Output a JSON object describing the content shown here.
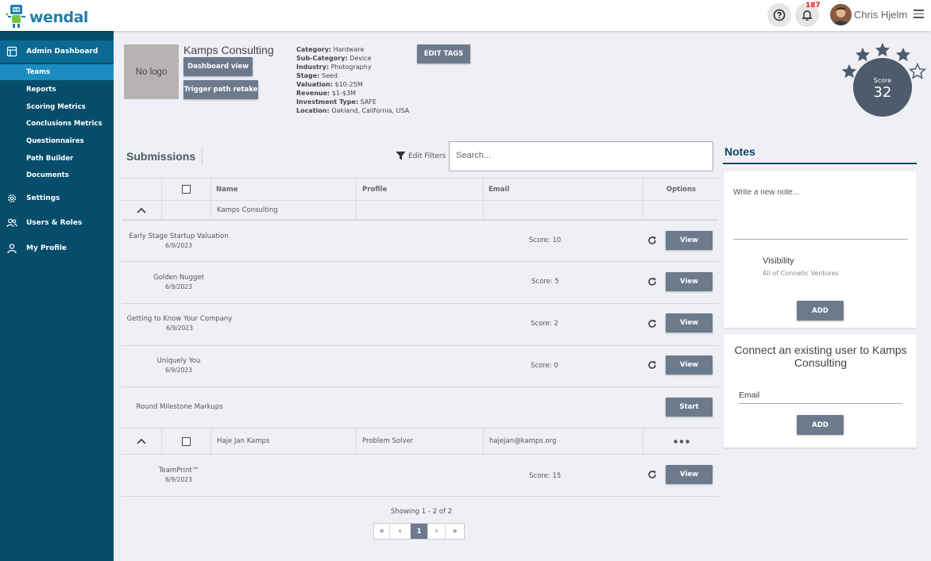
{
  "app": {
    "logo_text": "wendal",
    "notification_count": "187",
    "user_name": "Chris Hjelm"
  },
  "sidebar": {
    "items": [
      {
        "label": "Admin Dashboard",
        "icon": "dashboard-icon",
        "active": true
      },
      {
        "label": "Teams",
        "sub": true,
        "active": true
      },
      {
        "label": "Reports",
        "sub": true
      },
      {
        "label": "Scoring Metrics",
        "sub": true
      },
      {
        "label": "Conclusions Metrics",
        "sub": true
      },
      {
        "label": "Questionnaires",
        "sub": true
      },
      {
        "label": "Path Builder",
        "sub": true
      },
      {
        "label": "Documents",
        "sub": true
      },
      {
        "label": "Settings",
        "icon": "gear-icon"
      },
      {
        "label": "Users & Roles",
        "icon": "users-icon"
      },
      {
        "label": "My Profile",
        "icon": "user-icon"
      }
    ]
  },
  "company": {
    "logo_placeholder": "No logo",
    "name": "Kamps Consulting",
    "dashboard_button": "Dashboard view",
    "retake_button": "Trigger path retake",
    "edit_tags_button": "EDIT TAGS",
    "details": [
      {
        "key": "Category:",
        "value": "Hardware"
      },
      {
        "key": "Sub-Category:",
        "value": "Device"
      },
      {
        "key": "Industry:",
        "value": "Photography"
      },
      {
        "key": "Stage:",
        "value": "Seed"
      },
      {
        "key": "Valuation:",
        "value": "$10-25M"
      },
      {
        "key": "Revenue:",
        "value": "$1-$3M"
      },
      {
        "key": "Investment Type:",
        "value": "SAFE"
      },
      {
        "key": "Location:",
        "value": "Oakland, California, USA"
      }
    ],
    "score_label": "Score",
    "score_value": "32",
    "stars_filled": 4,
    "stars_total": 5
  },
  "submissions": {
    "title": "Submissions",
    "filter_label": "Edit Filters",
    "search_placeholder": "Search...",
    "columns": [
      "Name",
      "Profile",
      "Email",
      "Options"
    ],
    "groups": [
      {
        "name": "Kamps Consulting",
        "profile": "",
        "email": "",
        "items": [
          {
            "name": "Early Stage Startup Valuation",
            "date": "6/9/2023",
            "score": "Score: 10",
            "action": "View"
          },
          {
            "name": "Golden Nugget",
            "date": "6/9/2023",
            "score": "Score: 5",
            "action": "View"
          },
          {
            "name": "Getting to Know Your Company",
            "date": "6/9/2023",
            "score": "Score: 2",
            "action": "View"
          },
          {
            "name": "Uniquely You",
            "date": "6/9/2023",
            "score": "Score: 0",
            "action": "View"
          },
          {
            "name": "Round Milestone Markups",
            "date": "",
            "score": "",
            "action": "Start"
          }
        ]
      },
      {
        "name": "Haje Jan Kamps",
        "profile": "Problem Solver",
        "email": "hajejan@kamps.org",
        "items": [
          {
            "name": "TeamPrint™",
            "date": "6/9/2023",
            "score": "Score: 15",
            "action": "View"
          }
        ]
      }
    ],
    "showing": "Showing 1 - 2 of 2",
    "pager": {
      "first": "«",
      "prev": "‹",
      "current": "1",
      "next": "›",
      "last": "»"
    }
  },
  "notes": {
    "title": "Notes",
    "placeholder": "Write a new note...",
    "visibility_label": "Visibility",
    "visibility_value": "All of Connetic Ventures",
    "add_button": "ADD",
    "connect_title": "Connect an existing user to Kamps Consulting",
    "email_label": "Email",
    "connect_add_button": "ADD"
  },
  "colors": {
    "sidebar": "#064c6b",
    "sidebar_active": "#0a6a93",
    "sidebar_sub_active": "#1b8dbf",
    "button": "#6c7a8c",
    "score_circle": "#4d5b6c",
    "notes_accent": "#10456a",
    "badge": "#e0201e"
  }
}
